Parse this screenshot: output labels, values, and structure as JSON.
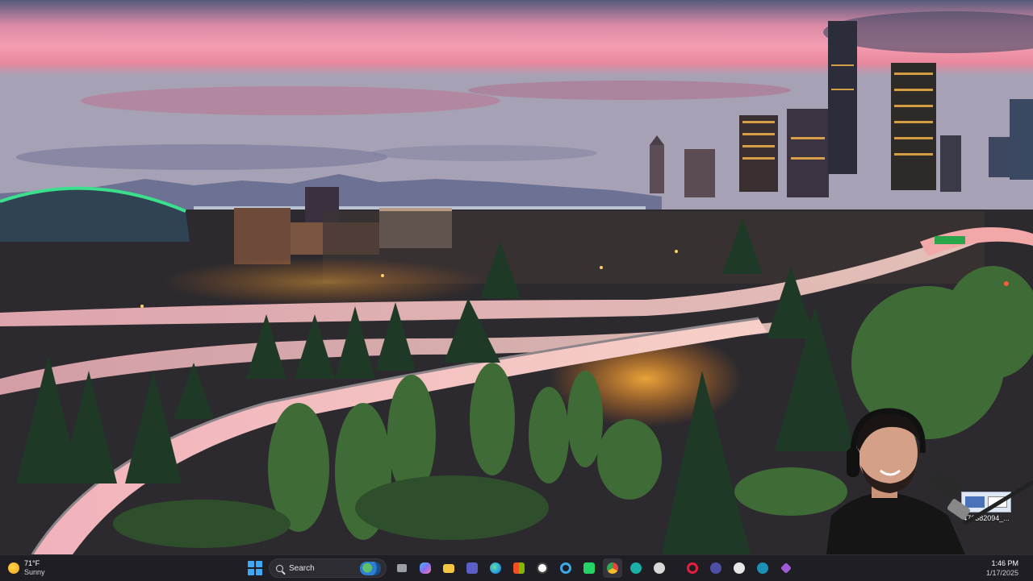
{
  "desktop": {
    "icon": {
      "label": "476382094_..."
    }
  },
  "taskbar": {
    "weather": {
      "temperature": "71°F",
      "condition": "Sunny"
    },
    "search": {
      "placeholder": "Search"
    },
    "pinned_apps": [
      {
        "name": "task-view-icon",
        "color": "#9aa0a6"
      },
      {
        "name": "copilot-icon",
        "color": "#8b6cf0"
      },
      {
        "name": "file-explorer-icon",
        "color": "#f3c640"
      },
      {
        "name": "teams-icon",
        "color": "#5b5fc7"
      },
      {
        "name": "edge-icon",
        "color": "#2a9ee0"
      },
      {
        "name": "store-icon",
        "color": "#2f89e0"
      },
      {
        "name": "dell-icon",
        "color": "#6b6b6b"
      },
      {
        "name": "cortana-icon",
        "color": "#3aa9e8"
      },
      {
        "name": "whatsapp-icon",
        "color": "#25d366"
      },
      {
        "name": "chrome-icon",
        "color": "#e8453c"
      },
      {
        "name": "edge-dev-icon",
        "color": "#1ab0a8"
      },
      {
        "name": "obs-icon",
        "color": "#d8d8d8"
      },
      {
        "name": "opera-icon",
        "color": "#e81e3e"
      },
      {
        "name": "app-icon",
        "color": "#4f4fa8"
      },
      {
        "name": "wordpress-icon",
        "color": "#e6e6e6"
      },
      {
        "name": "edge-beta-icon",
        "color": "#1d90b8"
      },
      {
        "name": "media-icon",
        "color": "#a05bd8"
      }
    ],
    "clock": {
      "time": "1:46 PM",
      "date": "1/17/2025"
    }
  }
}
